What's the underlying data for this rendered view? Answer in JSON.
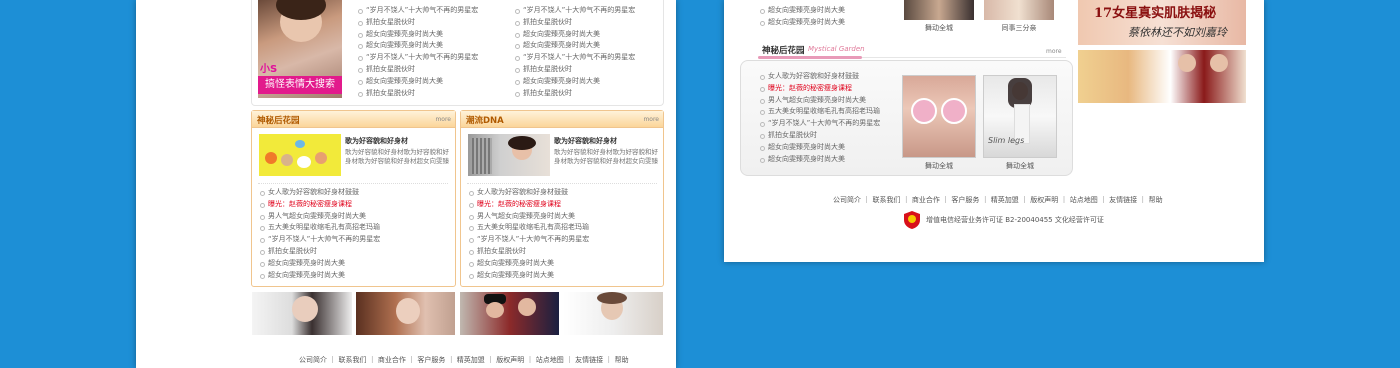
{
  "left": {
    "top_lists": [
      [
        "“岁月不饶人”十大帅气不再的男星宏",
        "抓拍女星脱伙时",
        "超女向雯臻亮身时尚大美",
        "超女向雯臻亮身时尚大美",
        "“岁月不饶人”十大帅气不再的男星宏",
        "抓拍女星脱伙时",
        "超女向雯臻亮身时尚大美",
        "抓拍女星脱伙时"
      ],
      [
        "“岁月不饶人”十大帅气不再的男星宏",
        "抓拍女星脱伙时",
        "超女向雯臻亮身时尚大美",
        "超女向雯臻亮身时尚大美",
        "“岁月不饶人”十大帅气不再的男星宏",
        "抓拍女星脱伙时",
        "超女向雯臻亮身时尚大美",
        "抓拍女星脱伙时"
      ]
    ],
    "promo_text": "搞怪表情大搜索",
    "promo_small": "小S",
    "panels": [
      {
        "title": "神秘后花园",
        "more": "more",
        "feature_title": "歌为好容貌和好身材",
        "feature_desc": "歌为好容貌和好身材歌为好容貌和好身材歌为好容貌和好身材超女向雯臻亮身时尚超什..."
      },
      {
        "title": "潮流DNA",
        "more": "more",
        "feature_title": "歌为好容貌和好身材",
        "feature_desc": "歌为好容貌和好身材歌为好容貌和好身材歌为好容貌和好身材超女向雯臻亮身时尚超什..."
      }
    ],
    "panel_list": [
      "女人歌为好容貌和好身材鼓鼓",
      "曝光：赵薇的秘密瘦身课程",
      "男人气超女向雯臻亮身时尚大美",
      "五大美女明星收缩毛孔有高招老玛瑜",
      "“岁月不饶人”十大帅气不再的男星宏",
      "抓拍女星脱伙时",
      "超女向雯臻亮身时尚大美",
      "超女向雯臻亮身时尚大美"
    ],
    "footer": "公司简介 ｜ 联系我们 ｜ 商业合作 ｜ 客户服务 ｜ 精英加盟 ｜ 版权声明 ｜ 站点地图 ｜ 友情链接 ｜ 帮助"
  },
  "right": {
    "top_list": [
      "超女向雯臻亮身时尚大美",
      "超女向雯臻亮身时尚大美"
    ],
    "captions_top": [
      "舞动全城",
      "同事三分亲"
    ],
    "ad1": "17女星真实肌肤揭秘",
    "ad2": "蔡依林还不如刘嘉玲",
    "section_title": "神秘后花园",
    "section_en": "Mystical Garden",
    "more": "more",
    "list": [
      "女人歌为好容貌和好身材鼓鼓",
      "曝光：赵薇的秘密瘦身课程",
      "男人气超女向雯臻亮身时尚大美",
      "五大美女明星收缩毛孔有高招老玛瑜",
      "“岁月不饶人”十大帅气不再的男星宏",
      "抓拍女星脱伙时",
      "超女向雯臻亮身时尚大美",
      "超女向雯臻亮身时尚大美"
    ],
    "captions": [
      "舞动全城",
      "舞动全城"
    ],
    "slim_text": "Slim legs",
    "footer": "公司简介 ｜ 联系我们 ｜ 商业合作 ｜ 客户服务 ｜ 精英加盟 ｜ 版权声明 ｜ 站点地图 ｜ 友情链接 ｜ 帮助",
    "license": "增值电信经营业务许可证 B2-20040455  文化经营许可证"
  }
}
